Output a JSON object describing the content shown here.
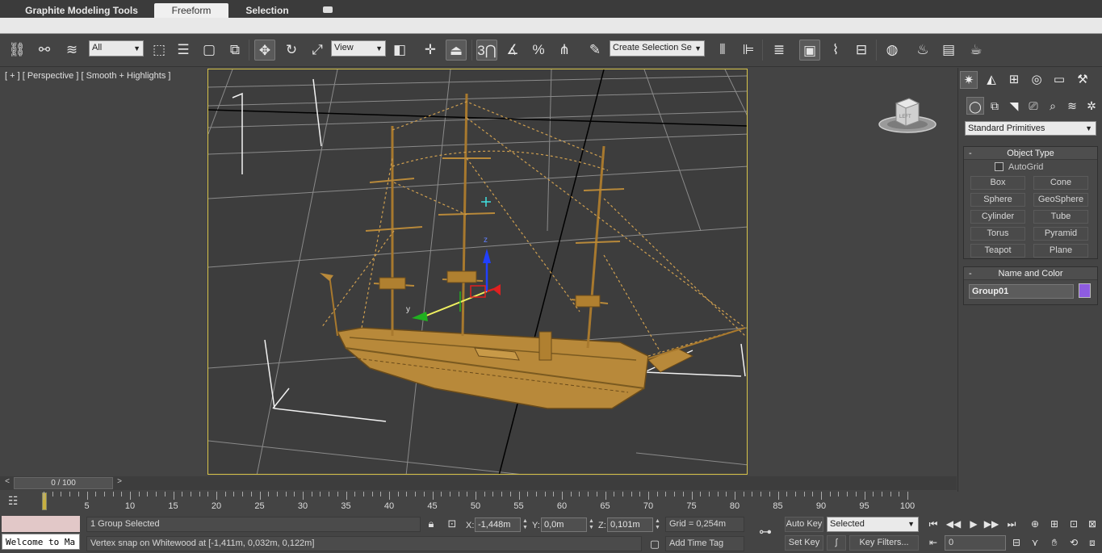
{
  "ribbon": {
    "tabs": [
      {
        "label": "Graphite Modeling Tools",
        "active": false
      },
      {
        "label": "Freeform",
        "active": true
      },
      {
        "label": "Selection",
        "active": false
      }
    ]
  },
  "toolbar": {
    "selection_filter": "All",
    "reference_coord": "View",
    "snap_value": "3",
    "named_selection_placeholder": "Create Selection Se"
  },
  "viewport": {
    "label": "[ + ] [ Perspective ] [ Smooth + Highlights ]",
    "axis_x": "x",
    "axis_y": "y",
    "axis_z": "z",
    "viewcube_face": "LEFT"
  },
  "command_panel": {
    "category": "Standard Primitives",
    "object_type": {
      "title": "Object Type",
      "autogrid": "AutoGrid",
      "buttons": [
        "Box",
        "Cone",
        "Sphere",
        "GeoSphere",
        "Cylinder",
        "Tube",
        "Torus",
        "Pyramid",
        "Teapot",
        "Plane"
      ]
    },
    "name_and_color": {
      "title": "Name and Color",
      "name": "Group01",
      "color": "#8e5ce0"
    }
  },
  "time_slider": {
    "position": "0 / 100",
    "prev": "<",
    "next": ">"
  },
  "track_bar": {
    "ticks": [
      "5",
      "10",
      "15",
      "20",
      "25",
      "30",
      "35",
      "40",
      "45",
      "50",
      "55",
      "60",
      "65",
      "70",
      "75",
      "80",
      "85",
      "90",
      "95",
      "100"
    ]
  },
  "status": {
    "maxscript_line": "Welcome to Ma",
    "selection_info": "1 Group Selected",
    "prompt": "Vertex snap on Whitewood at [-1,411m, 0,032m, 0,122m]",
    "x_label": "X:",
    "x_value": "-1,448m",
    "y_label": "Y:",
    "y_value": "0,0m",
    "z_label": "Z:",
    "z_value": "0,101m",
    "grid": "Grid = 0,254m",
    "add_time_tag": "Add Time Tag",
    "auto_key": "Auto Key",
    "set_key": "Set Key",
    "key_mode": "Selected",
    "key_filters": "Key Filters...",
    "current_frame": "0"
  },
  "colors": {
    "viewport_border": "#d8c44a",
    "ship": "#b8893a",
    "gizmo_x": "#e02020",
    "gizmo_y": "#20b020",
    "gizmo_z": "#2040ff"
  }
}
